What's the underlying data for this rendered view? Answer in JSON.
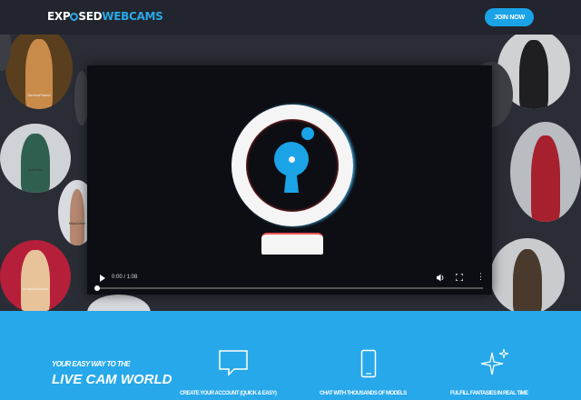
{
  "header": {
    "logo_part1": "EXP",
    "logo_part2": "SED",
    "logo_part3": "WEBCAMS",
    "join_label": "JOIN NOW"
  },
  "models": [
    {
      "name": "SerenaFlanne"
    },
    {
      "name": "Babeliila"
    },
    {
      "name": "MilaGreen"
    },
    {
      "name": "AmandaHeaven"
    },
    {
      "name": "MelanieDouce"
    }
  ],
  "video": {
    "time": "0:00 / 1:08",
    "progress": 0
  },
  "promo": {
    "tagline_small": "YOUR EASY WAY TO THE",
    "tagline_big": "LIVE CAM WORLD",
    "features": [
      {
        "icon": "chat-bubble-icon",
        "text": "CREATE YOUR ACCOUNT (QUICK & EASY)"
      },
      {
        "icon": "phone-icon",
        "text": "CHAT WITH THOUSANDS OF MODELS"
      },
      {
        "icon": "sparkle-icon",
        "text": "FULFILL FANTASIES IN REAL TIME"
      }
    ]
  },
  "colors": {
    "accent": "#1aa3e6",
    "promo_bg": "#27a8ea",
    "header_bg": "#22252d"
  }
}
